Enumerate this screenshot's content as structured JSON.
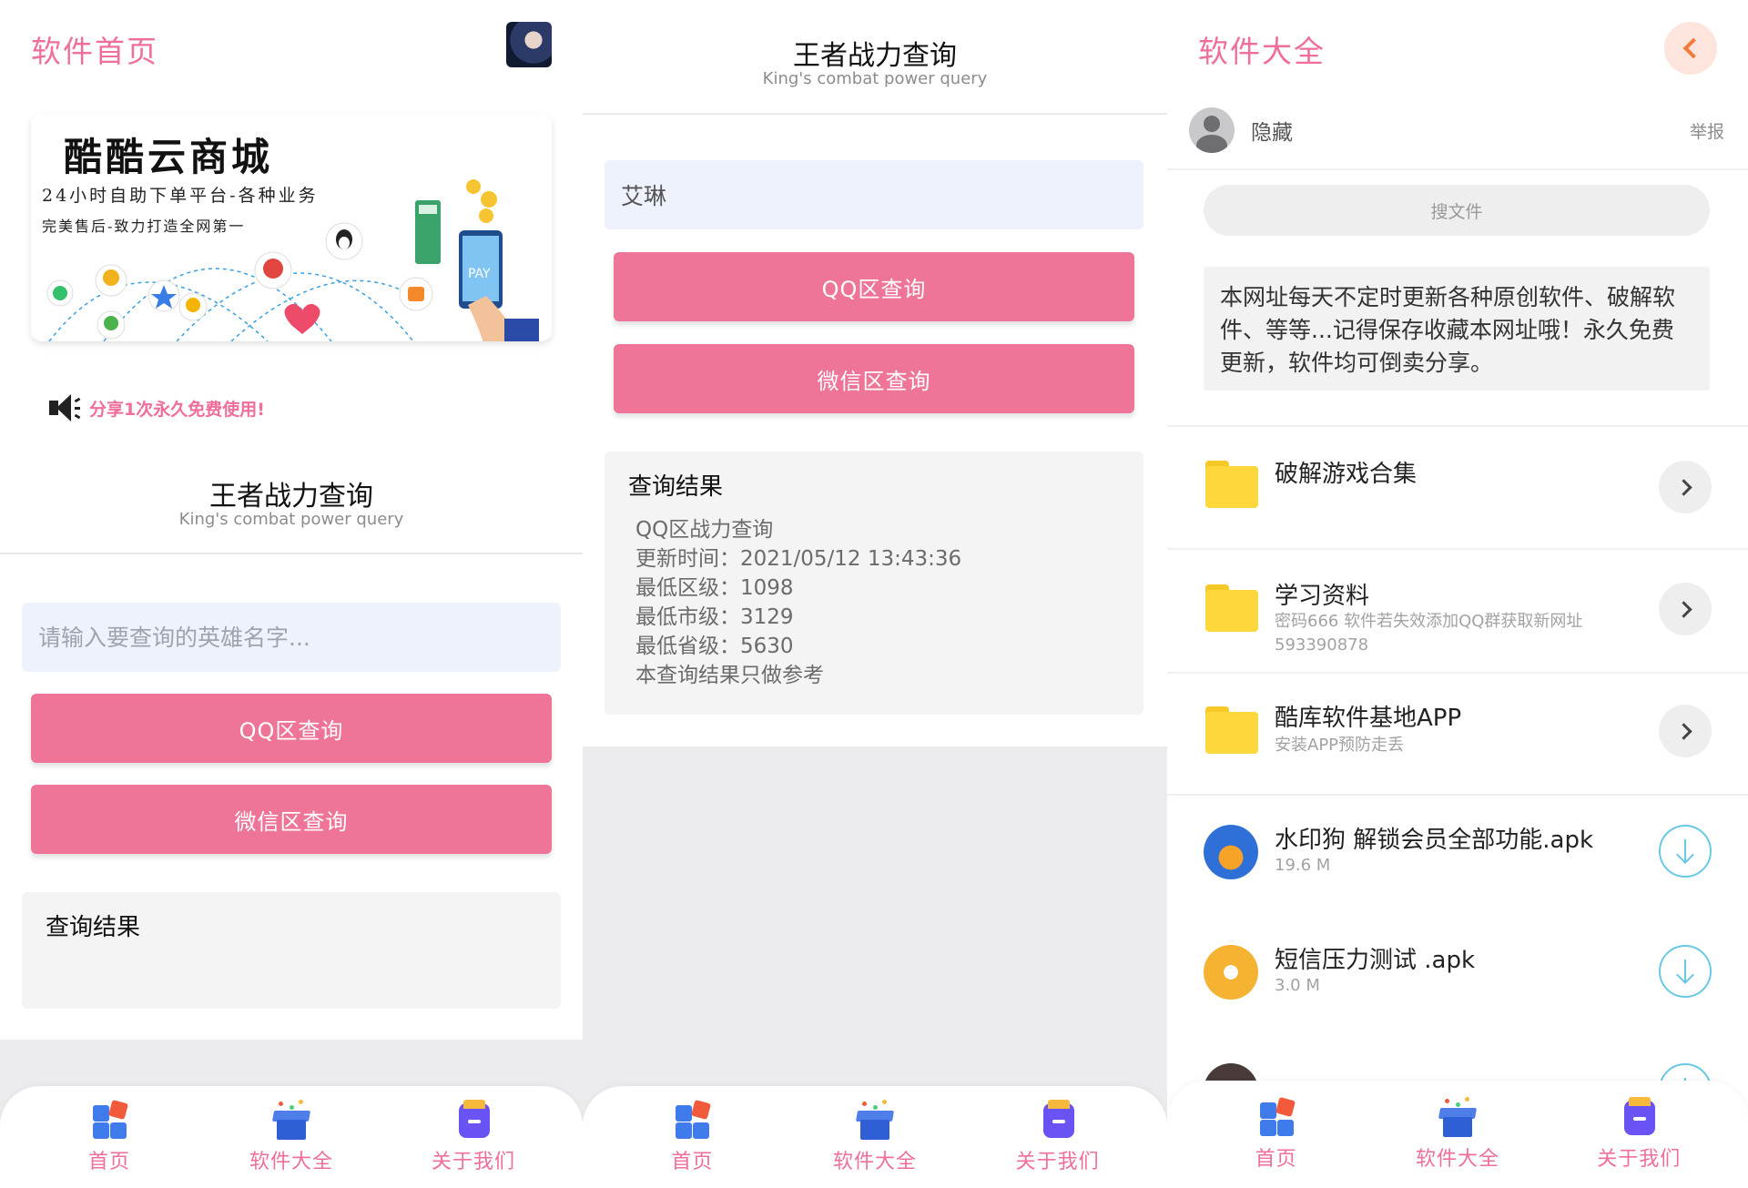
{
  "panel1": {
    "header_title": "软件首页",
    "banner": {
      "title": "酷酷云商城",
      "line1": "24小时自助下单平台-各种业务",
      "line2": "完美售后-致力打造全网第一"
    },
    "notice": "分享1次永久免费使用!",
    "section_title": "王者战力查询",
    "section_subtitle": "King's combat power query",
    "input_placeholder": "请输入要查询的英雄名字...",
    "qq_button": "QQ区查询",
    "wechat_button": "微信区查询",
    "result_title": "查询结果"
  },
  "panel2": {
    "header_title": "王者战力查询",
    "header_subtitle": "King's combat power query",
    "input_value": "艾琳",
    "qq_button": "QQ区查询",
    "wechat_button": "微信区查询",
    "result_title": "查询结果",
    "result_lines": [
      "QQ区战力查询",
      "更新时间：2021/05/12 13:43:36",
      "最低区级：1098",
      "最低市级：3129",
      "最低省级：5630",
      "本查询结果只做参考"
    ]
  },
  "panel3": {
    "header_title": "软件大全",
    "user_name": "隐藏",
    "report": "举报",
    "search": "搜文件",
    "info": "本网址每天不定时更新各种原创软件、破解软件、等等...记得保存收藏本网址哦！永久免费更新，软件均可倒卖分享。",
    "folders": [
      {
        "title": "破解游戏合集",
        "sub": ""
      },
      {
        "title": "学习资料",
        "sub": "密码666 软件若失效添加QQ群获取新网址593390878"
      },
      {
        "title": "酷库软件基地APP",
        "sub": "安装APP预防走丢"
      }
    ],
    "files": [
      {
        "title": "水印狗 解锁会员全部功能.apk",
        "size": "19.6 M"
      },
      {
        "title": "短信压力测试 .apk",
        "size": "3.0 M"
      }
    ]
  },
  "tabbar": {
    "home": "首页",
    "software": "软件大全",
    "about": "关于我们"
  },
  "colors": {
    "accent_pink": "#ef6f98",
    "button_pink": "#ef7598",
    "input_bg": "#eef2fc",
    "download_blue": "#69c8e3"
  }
}
